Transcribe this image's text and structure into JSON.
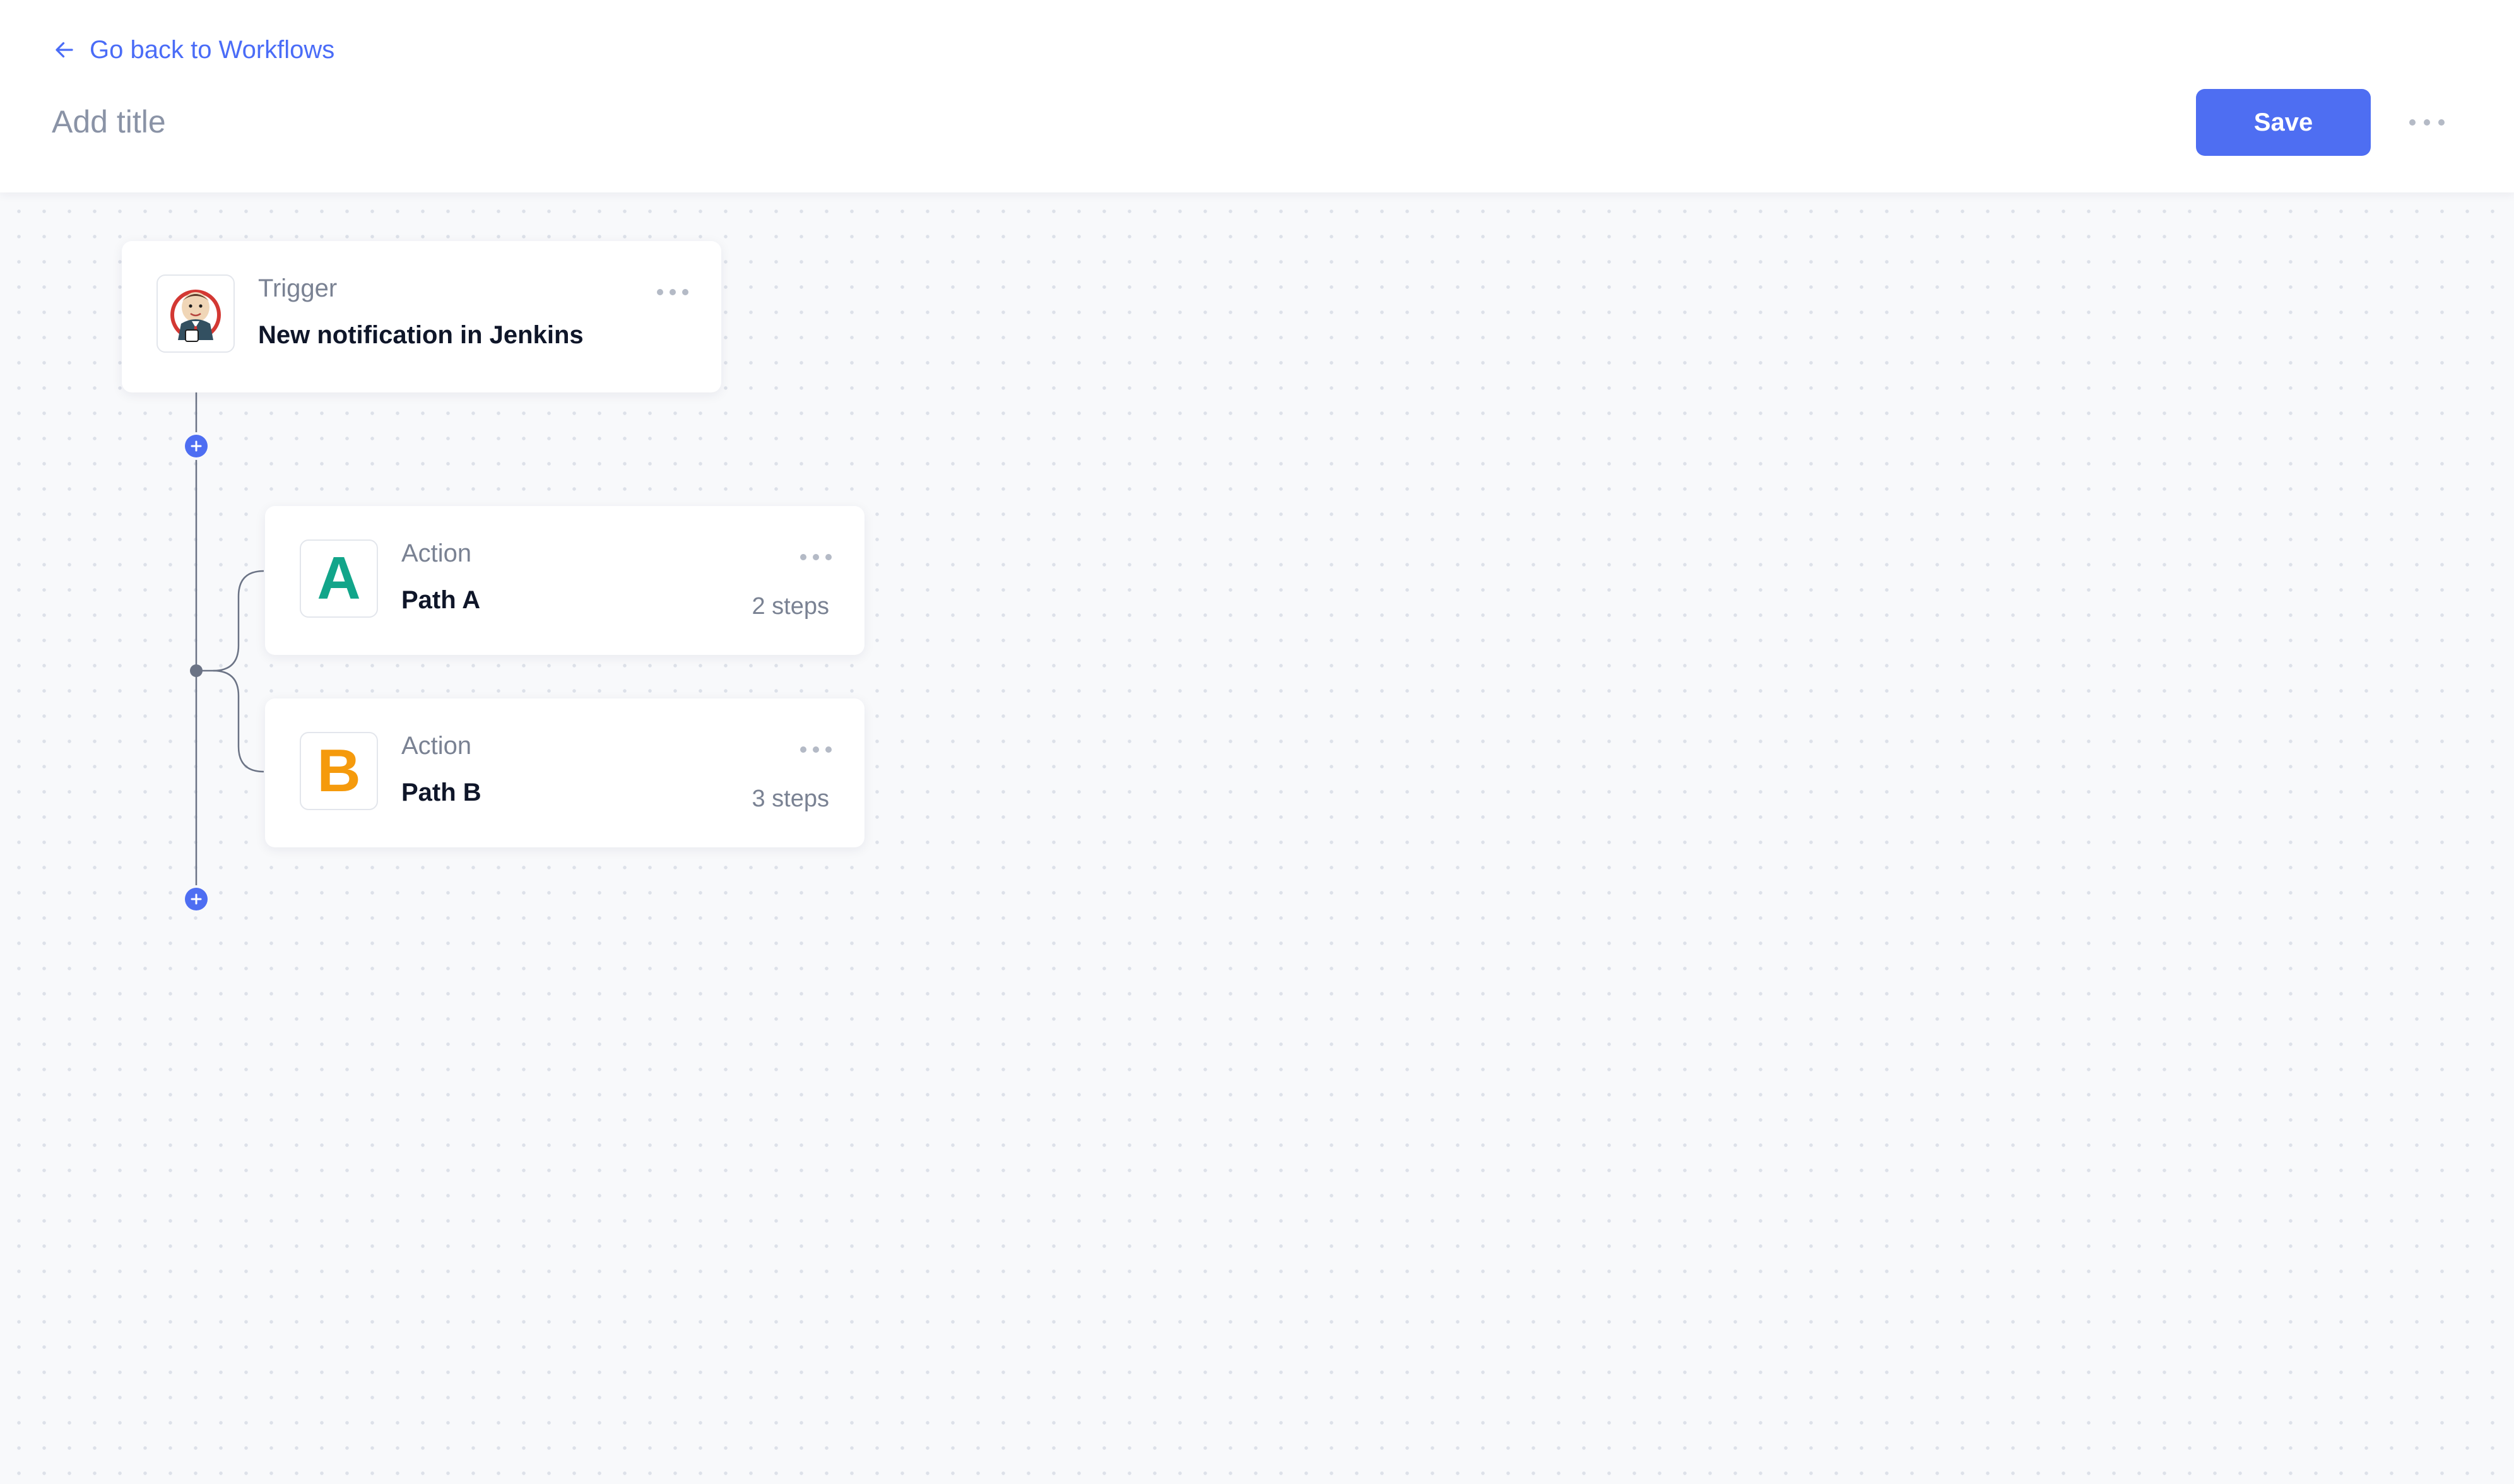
{
  "header": {
    "back_label": "Go back to Workflows",
    "title_placeholder": "Add title",
    "title_value": "",
    "save_label": "Save"
  },
  "workflow": {
    "trigger": {
      "label": "Trigger",
      "title": "New notification in Jenkins",
      "icon": "jenkins-logo"
    },
    "paths": [
      {
        "letter": "A",
        "label": "Action",
        "title": "Path A",
        "steps": "2 steps",
        "color": "#12a58a"
      },
      {
        "letter": "B",
        "label": "Action",
        "title": "Path B",
        "steps": "3 steps",
        "color": "#f59a0c"
      }
    ]
  },
  "colors": {
    "accent": "#4e6ef2",
    "link": "#4a6cf7",
    "connector": "#6b7385",
    "canvas": "#f8f9fb"
  },
  "icons": {
    "back": "arrow-left-icon",
    "more": "more-horizontal-icon",
    "add": "plus-icon"
  }
}
